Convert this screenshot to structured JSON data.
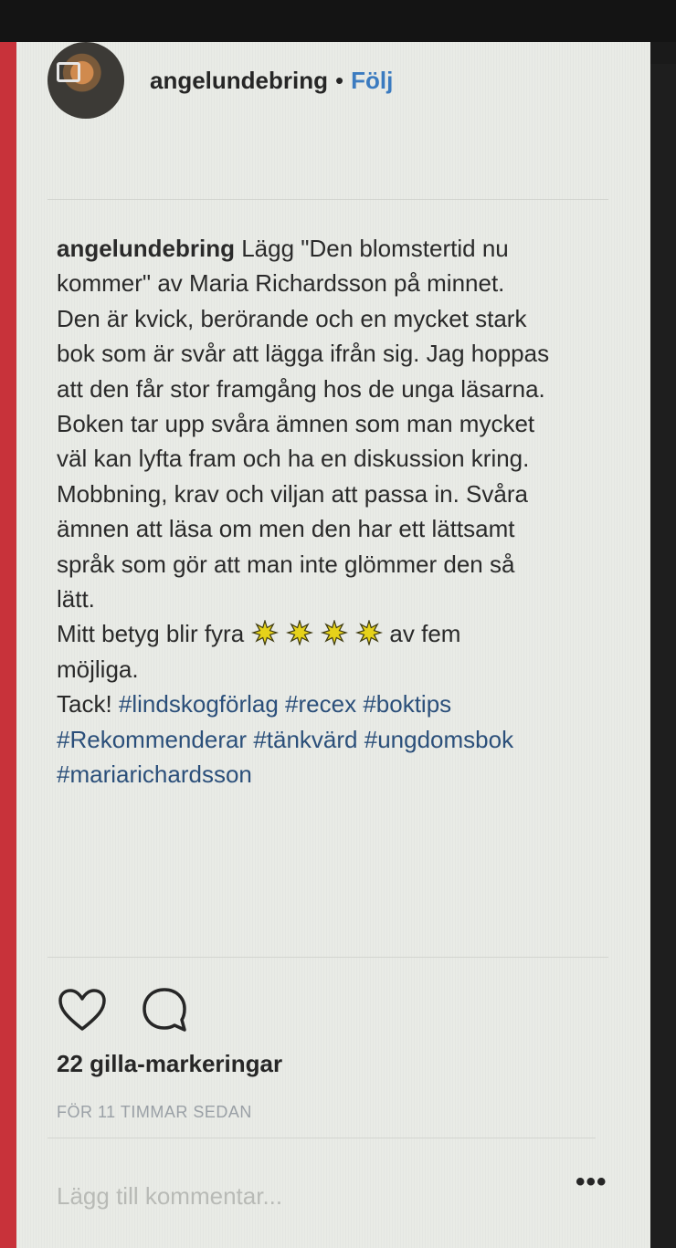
{
  "post": {
    "username": "angelundebring",
    "separator": "•",
    "follow_label": "Följ",
    "caption_username": "angelundebring",
    "caption_text": " Lägg \"Den blomstertid nu\nkommer\" av Maria Richardsson på minnet.\nDen är kvick, berörande och en mycket stark\nbok som är svår att lägga ifrån sig. Jag hoppas\natt den får stor framgång hos de unga läsarna.\nBoken tar upp svåra ämnen som man mycket\nväl kan lyfta fram och ha en diskussion kring.\nMobbning, krav och viljan att passa in. Svåra\nämnen att läsa om men den har ett lättsamt\nspråk som gör att man inte glömmer den så\nlätt.\n",
    "rating_prefix": "Mitt betyg blir fyra ",
    "rating_value": 4,
    "rating_suffix": "av fem\nmöjliga.\n",
    "thanks": "Tack! ",
    "hashtags": [
      "#lindskogförlag",
      "#recex",
      "#boktips",
      "#Rekommenderar",
      "#tänkvärd",
      "#ungdomsbok",
      "#mariarichardsson"
    ],
    "likes_text": "22 gilla-markeringar",
    "timestamp": "FÖR 11 TIMMAR SEDAN",
    "comment_placeholder": "Lägg till kommentar...",
    "more_label": "•••"
  },
  "icons": {
    "like": "heart-icon",
    "comment": "comment-bubble-icon",
    "star": "star-emoji-icon",
    "more": "ellipsis-icon"
  },
  "colors": {
    "follow": "#3b7bc0",
    "hashtag": "#2b4f7a",
    "star_fill": "#e6d21a",
    "timestamp": "#9aa0a6"
  }
}
